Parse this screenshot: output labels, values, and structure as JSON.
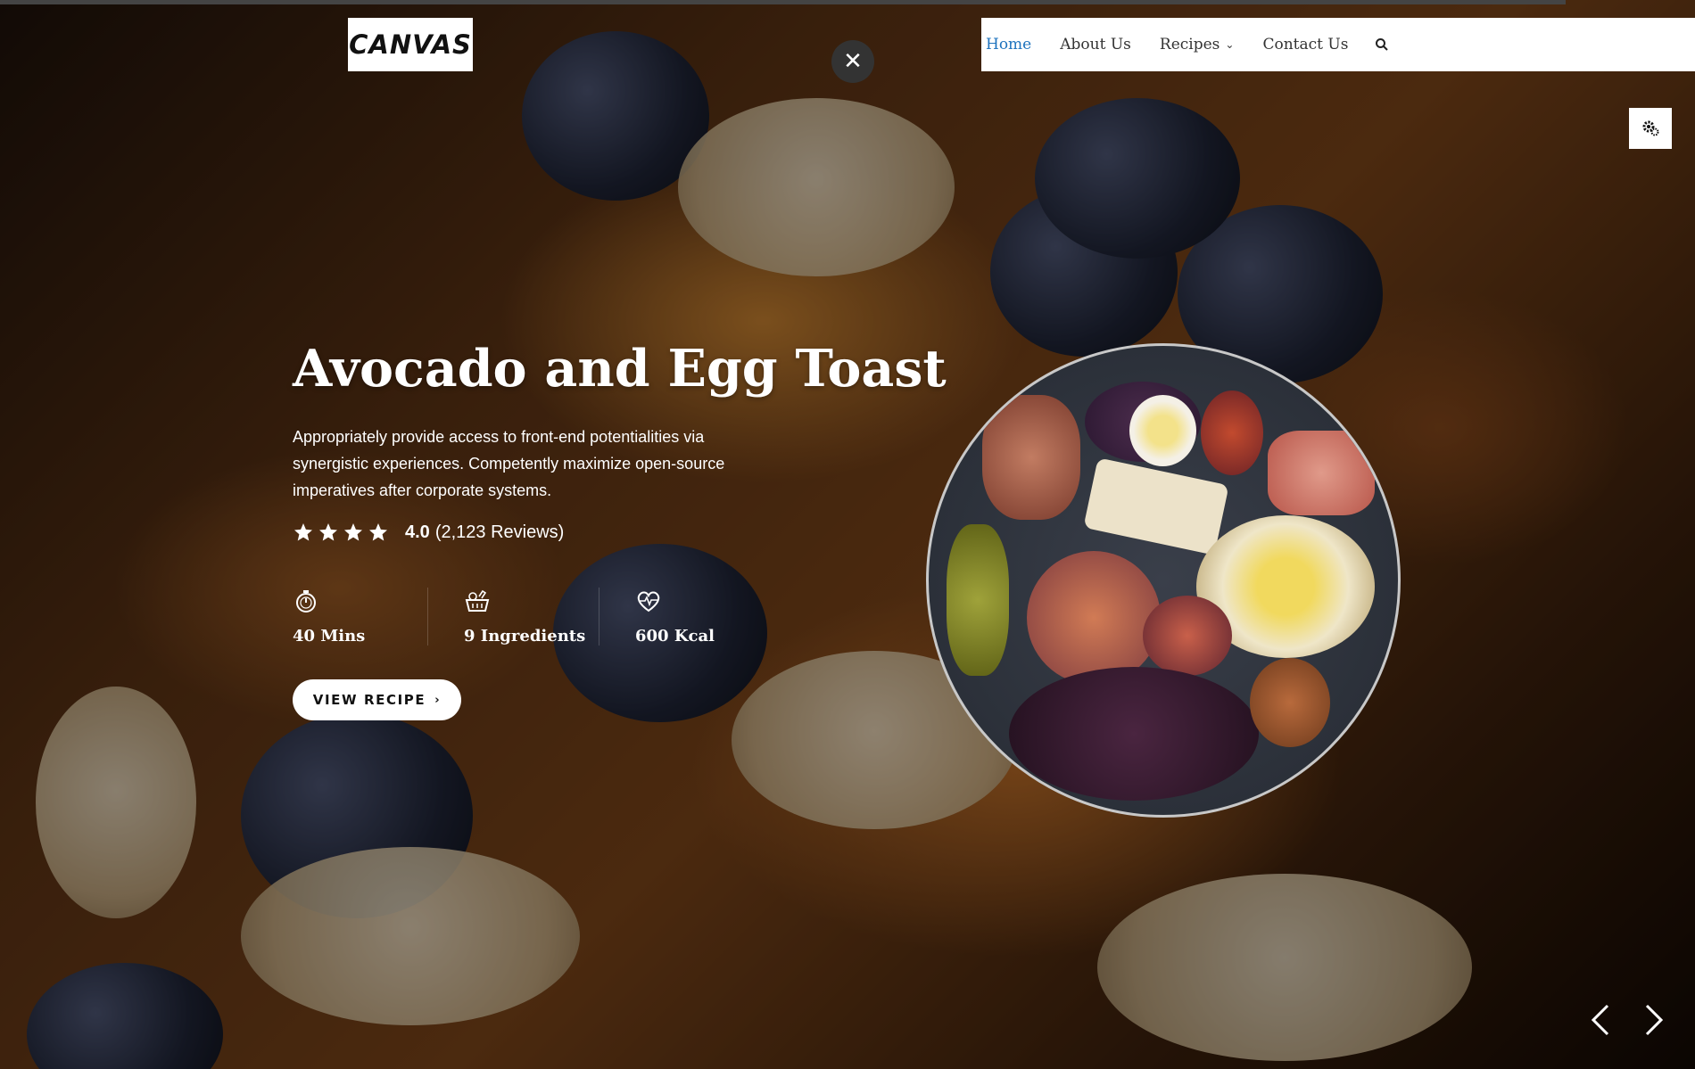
{
  "brand": {
    "logo_text": "CANVAS"
  },
  "nav": {
    "items": [
      {
        "label": "Home",
        "active": true
      },
      {
        "label": "About Us"
      },
      {
        "label": "Recipes",
        "has_dropdown": true
      },
      {
        "label": "Contact Us"
      }
    ],
    "search_icon": "search-icon"
  },
  "close_icon": "close-icon",
  "settings_icon": "gears-icon",
  "hero": {
    "title": "Avocado and Egg Toast",
    "description": "Appropriately provide access to front-end potentialities via synergistic experiences. Competently maximize open-source imperatives after corporate systems.",
    "rating": {
      "stars": 4,
      "value": "4.0",
      "reviews": "(2,123 Reviews)"
    },
    "stats": [
      {
        "icon": "stopwatch-icon",
        "label": "40 Mins"
      },
      {
        "icon": "basket-icon",
        "label": "9 Ingredients"
      },
      {
        "icon": "heartbeat-icon",
        "label": "600 Kcal"
      }
    ],
    "cta": {
      "label": "VIEW RECIPE",
      "icon": "chevron-right-icon"
    }
  },
  "slider": {
    "prev_icon": "chevron-left-icon",
    "next_icon": "chevron-right-icon"
  },
  "colors": {
    "accent": "#1e73be",
    "text_light": "#ffffff",
    "nav_text": "#333333"
  }
}
